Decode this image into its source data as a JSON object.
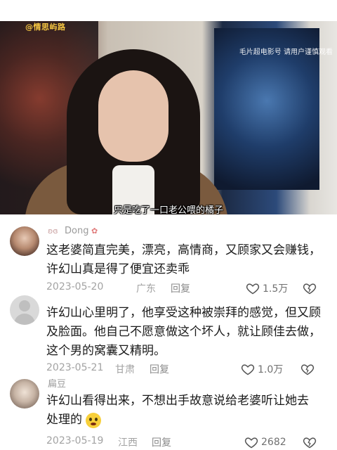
{
  "video": {
    "watermark": "@情思屿路",
    "top_right_caption": "毛片超电影号 请用户谨慎观看",
    "subtitle": "只是吃了一口老公喂的橘子"
  },
  "comments": [
    {
      "username": "Dong",
      "text": "这老婆简直完美，漂亮，高情商，又顾家又会赚钱，许幻山真是得了便宜还卖乖",
      "date": "2023-05-20",
      "location": "广东",
      "reply_label": "回复",
      "likes": "1.5万"
    },
    {
      "username": "",
      "text": "许幻山心里明了，他享受这种被崇拜的感觉，但又顾及脸面。他自己不愿意做这个坏人，就让顾佳去做，这个男的窝囊又精明。",
      "date": "2023-05-21",
      "location": "甘肃",
      "reply_label": "回复",
      "likes": "1.0万"
    },
    {
      "username": "扁豆",
      "text": "许幻山看得出来，不想出手故意说给老婆听让她去处理的",
      "date": "2023-05-19",
      "location": "江西",
      "reply_label": "回复",
      "likes": "2682"
    }
  ],
  "colors": {
    "watermark": "#f4c542",
    "meta_text": "#a3a3a3",
    "body_text": "#1a1a1a"
  }
}
